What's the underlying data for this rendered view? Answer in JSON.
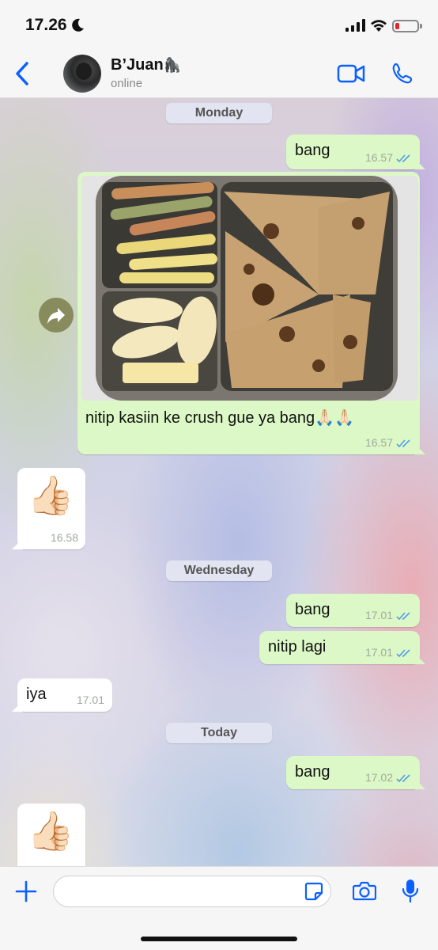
{
  "status_bar": {
    "time": "17.26"
  },
  "header": {
    "contact_name": "B’Juan",
    "contact_emoji": "🦍",
    "contact_status": "online"
  },
  "date_separators": {
    "monday": "Monday",
    "wednesday": "Wednesday",
    "today": "Today"
  },
  "messages": [
    {
      "id": "m1",
      "direction": "out",
      "text": "bang",
      "time": "16.57",
      "read": true
    },
    {
      "id": "m2",
      "direction": "out",
      "type": "image",
      "caption": "nitip kasiin ke crush gue ya bang🙏🏻🙏🏻",
      "time": "16.57",
      "read": true,
      "image_desc": "lunch box"
    },
    {
      "id": "m3",
      "direction": "in",
      "type": "sticker",
      "emoji": "👍🏻",
      "time": "16.58"
    },
    {
      "id": "m4",
      "direction": "out",
      "text": "bang",
      "time": "17.01",
      "read": true
    },
    {
      "id": "m5",
      "direction": "out",
      "text": "nitip lagi",
      "time": "17.01",
      "read": true
    },
    {
      "id": "m6",
      "direction": "in",
      "text": "iya",
      "time": "17.01"
    },
    {
      "id": "m7",
      "direction": "out",
      "text": "bang",
      "time": "17.02",
      "read": true
    },
    {
      "id": "m8",
      "direction": "in",
      "type": "sticker",
      "emoji": "👍🏻"
    }
  ],
  "composer": {
    "placeholder": "",
    "value": ""
  },
  "colors": {
    "accent": "#0a60ff",
    "outgoing_bubble": "#dcf8c6",
    "incoming_bubble": "#ffffff",
    "read_ticks": "#4f9ee6",
    "battery_low": "#e0262b"
  },
  "icons": {
    "back": "chevron-left-icon",
    "video": "video-camera-icon",
    "call": "phone-icon",
    "forward": "forward-arrow-icon",
    "plus": "plus-icon",
    "sticker": "sticker-icon",
    "camera": "camera-icon",
    "mic": "microphone-icon"
  }
}
